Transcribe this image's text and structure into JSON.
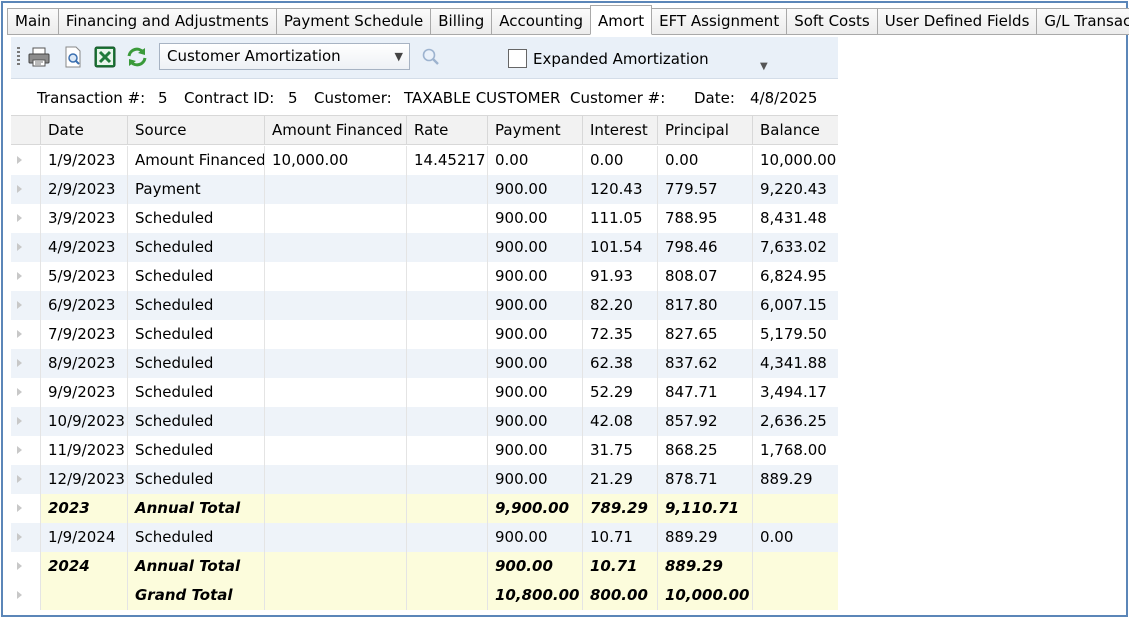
{
  "tabs": [
    {
      "label": "Main",
      "active": false
    },
    {
      "label": "Financing and Adjustments",
      "active": false
    },
    {
      "label": "Payment Schedule",
      "active": false
    },
    {
      "label": "Billing",
      "active": false
    },
    {
      "label": "Accounting",
      "active": false
    },
    {
      "label": "Amort",
      "active": true
    },
    {
      "label": "EFT Assignment",
      "active": false
    },
    {
      "label": "Soft Costs",
      "active": false
    },
    {
      "label": "User Defined Fields",
      "active": false
    },
    {
      "label": "G/L Transaction",
      "active": false
    }
  ],
  "toolbar": {
    "report_select": "Customer Amortization",
    "expanded_label": "Expanded Amortization",
    "expanded_checked": false,
    "icons": [
      "print-icon",
      "print-preview-icon",
      "excel-export-icon",
      "refresh-icon",
      "search-icon"
    ]
  },
  "info": {
    "transaction_label": "Transaction #:",
    "transaction_value": "5",
    "contract_label": "Contract ID:",
    "contract_value": "5",
    "customer_label": "Customer:",
    "customer_value": "TAXABLE CUSTOMER",
    "customer_num_label": "Customer #:",
    "customer_num_value": "",
    "date_label": "Date:",
    "date_value": "4/8/2025"
  },
  "grid": {
    "columns": [
      "Date",
      "Source",
      "Amount Financed",
      "Rate",
      "Payment",
      "Interest",
      "Principal",
      "Balance"
    ],
    "rows": [
      {
        "type": "row",
        "cells": [
          "1/9/2023",
          "Amount Financed",
          "10,000.00",
          "14.45217",
          "0.00",
          "0.00",
          "0.00",
          "10,000.00"
        ]
      },
      {
        "type": "row",
        "cells": [
          "2/9/2023",
          "Payment",
          "",
          "",
          "900.00",
          "120.43",
          "779.57",
          "9,220.43"
        ]
      },
      {
        "type": "row",
        "cells": [
          "3/9/2023",
          "Scheduled",
          "",
          "",
          "900.00",
          "111.05",
          "788.95",
          "8,431.48"
        ]
      },
      {
        "type": "row",
        "cells": [
          "4/9/2023",
          "Scheduled",
          "",
          "",
          "900.00",
          "101.54",
          "798.46",
          "7,633.02"
        ]
      },
      {
        "type": "row",
        "cells": [
          "5/9/2023",
          "Scheduled",
          "",
          "",
          "900.00",
          "91.93",
          "808.07",
          "6,824.95"
        ]
      },
      {
        "type": "row",
        "cells": [
          "6/9/2023",
          "Scheduled",
          "",
          "",
          "900.00",
          "82.20",
          "817.80",
          "6,007.15"
        ]
      },
      {
        "type": "row",
        "cells": [
          "7/9/2023",
          "Scheduled",
          "",
          "",
          "900.00",
          "72.35",
          "827.65",
          "5,179.50"
        ]
      },
      {
        "type": "row",
        "cells": [
          "8/9/2023",
          "Scheduled",
          "",
          "",
          "900.00",
          "62.38",
          "837.62",
          "4,341.88"
        ]
      },
      {
        "type": "row",
        "cells": [
          "9/9/2023",
          "Scheduled",
          "",
          "",
          "900.00",
          "52.29",
          "847.71",
          "3,494.17"
        ]
      },
      {
        "type": "row",
        "cells": [
          "10/9/2023",
          "Scheduled",
          "",
          "",
          "900.00",
          "42.08",
          "857.92",
          "2,636.25"
        ]
      },
      {
        "type": "row",
        "cells": [
          "11/9/2023",
          "Scheduled",
          "",
          "",
          "900.00",
          "31.75",
          "868.25",
          "1,768.00"
        ]
      },
      {
        "type": "row",
        "cells": [
          "12/9/2023",
          "Scheduled",
          "",
          "",
          "900.00",
          "21.29",
          "878.71",
          "889.29"
        ]
      },
      {
        "type": "total",
        "cells": [
          "2023",
          "Annual Total",
          "",
          "",
          "9,900.00",
          "789.29",
          "9,110.71",
          ""
        ]
      },
      {
        "type": "row",
        "cells": [
          "1/9/2024",
          "Scheduled",
          "",
          "",
          "900.00",
          "10.71",
          "889.29",
          "0.00"
        ]
      },
      {
        "type": "total",
        "cells": [
          "2024",
          "Annual Total",
          "",
          "",
          "900.00",
          "10.71",
          "889.29",
          ""
        ]
      },
      {
        "type": "total",
        "cells": [
          "",
          "Grand Total",
          "",
          "",
          "10,800.00",
          "800.00",
          "10,000.00",
          ""
        ]
      }
    ]
  }
}
